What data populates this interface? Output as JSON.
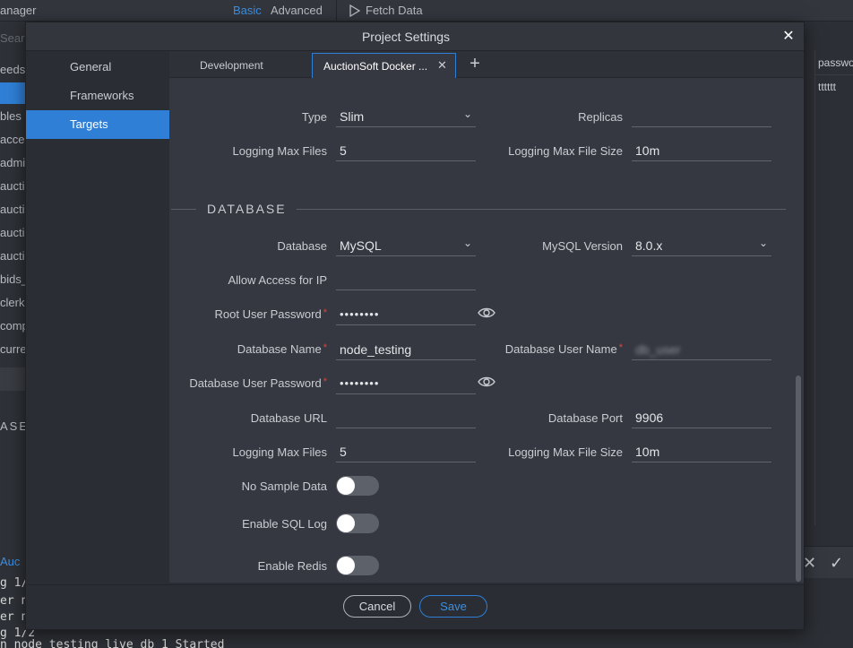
{
  "background": {
    "app_title": "anager",
    "mode_basic": "Basic",
    "mode_advanced": "Advanced",
    "fetch_label": "Fetch Data",
    "search_placeholder": "Searc",
    "sidebar_items": [
      "eeds",
      "bles",
      "acces",
      "admi",
      "aucti",
      "aucti",
      "aucti",
      "aucti",
      "bids_",
      "clerk",
      "comp",
      "curre"
    ],
    "section_label": "ASE",
    "right_header": "passwo",
    "right_cell": "tttttt",
    "console_lines": [
      "g 1/",
      "er n",
      "er n",
      "g 1/2"
    ],
    "console_link": "Auc",
    "console_bottom": "n node_testing  live_db_1   Started"
  },
  "modal": {
    "title": "Project Settings",
    "close_icon": "close-icon",
    "nav": [
      "General",
      "Frameworks",
      "Targets"
    ],
    "nav_active": "Targets",
    "tabs": [
      {
        "label": "Development"
      },
      {
        "label": "AuctionSoft Docker ..."
      }
    ],
    "active_tab": "AuctionSoft Docker ...",
    "top": {
      "type_label": "Type",
      "type_value": "Slim",
      "replicas_label": "Replicas",
      "replicas_value": "",
      "log_files_label": "Logging Max Files",
      "log_files_value": "5",
      "log_size_label": "Logging Max File Size",
      "log_size_value": "10m"
    },
    "database": {
      "section_title": "DATABASE",
      "db_label": "Database",
      "db_value": "MySQL",
      "mysql_version_label": "MySQL Version",
      "mysql_version_value": "8.0.x",
      "allow_ip_label": "Allow Access for IP",
      "allow_ip_value": "",
      "root_pw_label": "Root User Password",
      "root_pw_value": "••••••••",
      "db_name_label": "Database Name",
      "db_name_value": "node_testing",
      "db_user_label": "Database User Name",
      "db_user_value": "db_user",
      "db_user_pw_label": "Database User Password",
      "db_user_pw_value": "••••••••",
      "db_url_label": "Database URL",
      "db_url_value": "",
      "db_port_label": "Database Port",
      "db_port_value": "9906",
      "log_files_label": "Logging Max Files",
      "log_files_value": "5",
      "log_size_label": "Logging Max File Size",
      "log_size_value": "10m",
      "no_sample_label": "No Sample Data",
      "no_sample_on": false,
      "sql_log_label": "Enable SQL Log",
      "sql_log_on": false,
      "redis_label": "Enable Redis",
      "redis_on": false
    },
    "footer": {
      "cancel": "Cancel",
      "save": "Save"
    }
  },
  "colors": {
    "accent": "#2f7fd6",
    "required": "#e0443b"
  }
}
